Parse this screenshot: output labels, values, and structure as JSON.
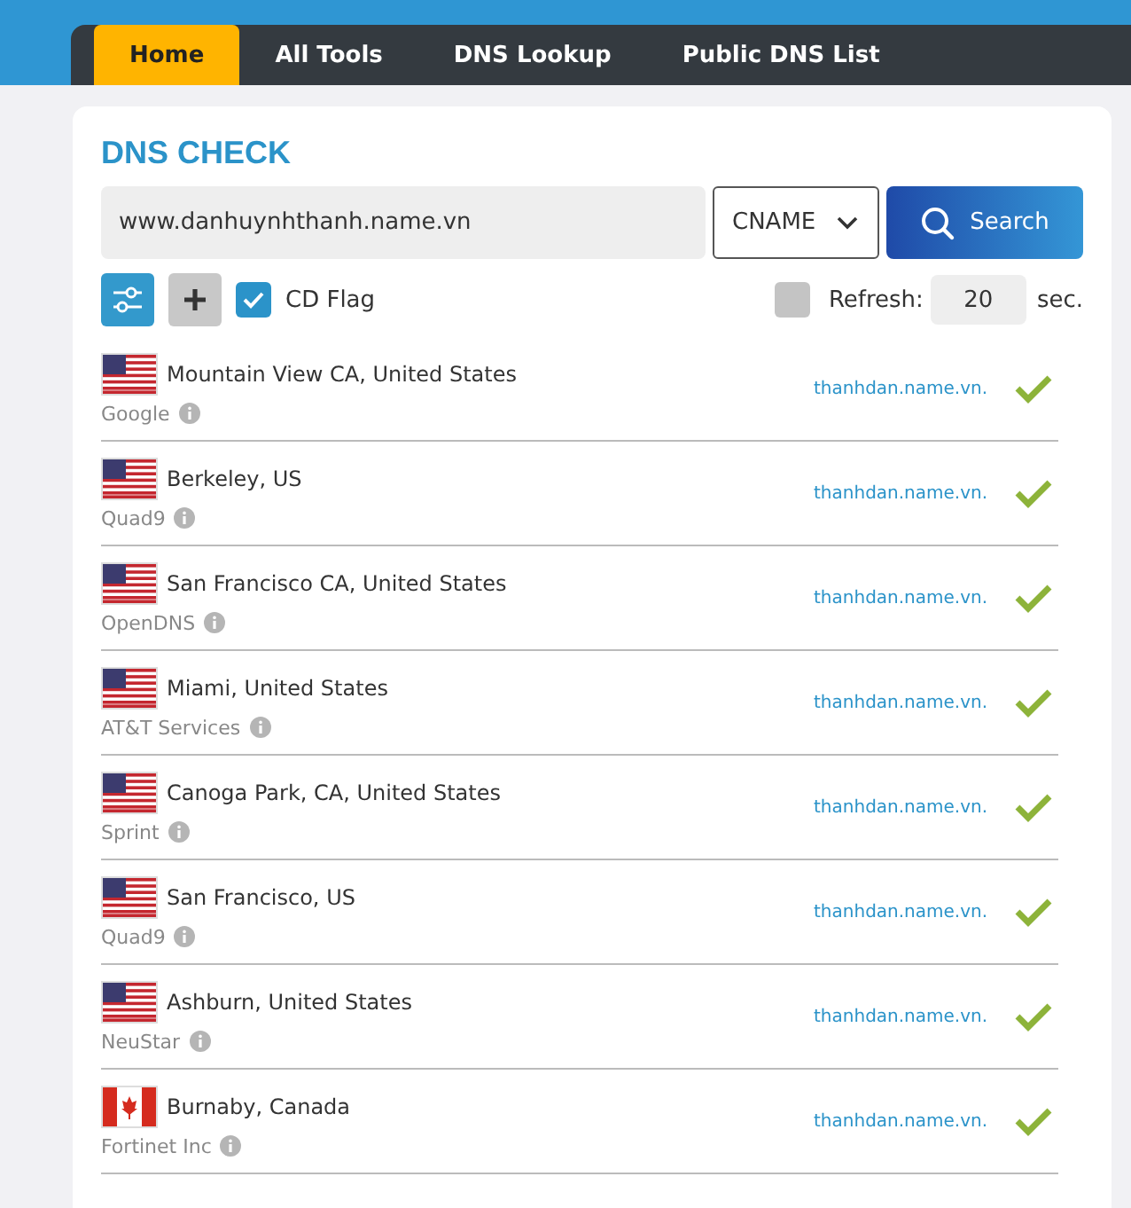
{
  "nav": {
    "tabs": [
      {
        "label": "Home",
        "selected": true
      },
      {
        "label": "All Tools",
        "selected": false
      },
      {
        "label": "DNS Lookup",
        "selected": false
      },
      {
        "label": "Public DNS List",
        "selected": false
      }
    ]
  },
  "card": {
    "title": "DNS CHECK",
    "domain": "www.danhuynhthanh.name.vn",
    "record_type": "CNAME",
    "search_button": "Search",
    "cd_flag": {
      "label": "CD Flag",
      "checked": true
    },
    "refresh": {
      "label": "Refresh:",
      "checked": false,
      "value": "20",
      "unit": "sec."
    },
    "results": [
      {
        "kind": "us",
        "location": "Mountain View CA, United States",
        "provider": "Google",
        "result": "thanhdan.name.vn.",
        "ok": true
      },
      {
        "kind": "us",
        "location": "Berkeley, US",
        "provider": "Quad9",
        "result": "thanhdan.name.vn.",
        "ok": true
      },
      {
        "kind": "us",
        "location": "San Francisco CA, United States",
        "provider": "OpenDNS",
        "result": "thanhdan.name.vn.",
        "ok": true
      },
      {
        "kind": "us",
        "location": "Miami, United States",
        "provider": "AT&T Services",
        "result": "thanhdan.name.vn.",
        "ok": true
      },
      {
        "kind": "us",
        "location": "Canoga Park, CA, United States",
        "provider": "Sprint",
        "result": "thanhdan.name.vn.",
        "ok": true
      },
      {
        "kind": "us",
        "location": "San Francisco, US",
        "provider": "Quad9",
        "result": "thanhdan.name.vn.",
        "ok": true
      },
      {
        "kind": "us",
        "location": "Ashburn, United States",
        "provider": "NeuStar",
        "result": "thanhdan.name.vn.",
        "ok": true
      },
      {
        "kind": "ca",
        "location": "Burnaby, Canada",
        "provider": "Fortinet Inc",
        "result": "thanhdan.name.vn.",
        "ok": true
      }
    ]
  }
}
